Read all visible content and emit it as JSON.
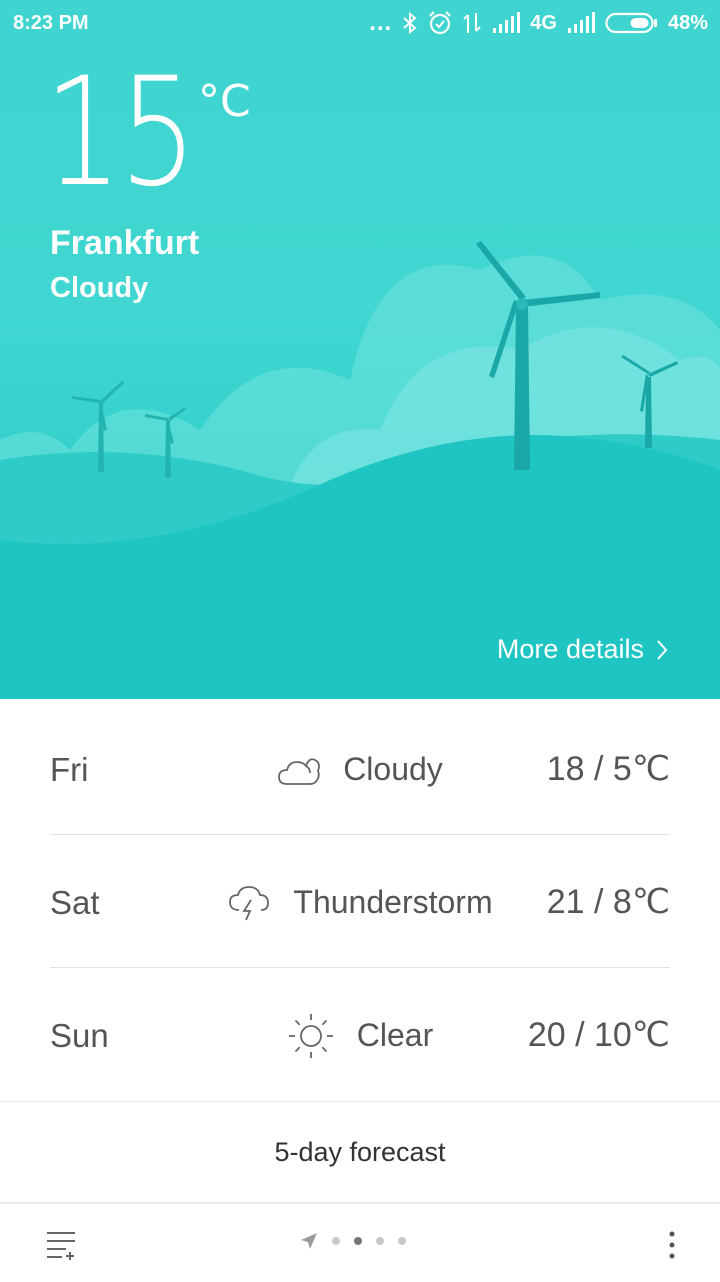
{
  "status_bar": {
    "time": "8:23 PM",
    "network": "4G",
    "battery": "48%",
    "battery_level": 0.48,
    "icons": [
      "more-dots-icon",
      "bluetooth-icon",
      "alarm-icon",
      "data-arrows-icon",
      "signal-icon",
      "signal-icon",
      "battery-icon"
    ]
  },
  "current": {
    "temperature": "15",
    "unit": "°C",
    "city": "Frankfurt",
    "condition": "Cloudy"
  },
  "more_details": "More details",
  "forecast": [
    {
      "day": "Fri",
      "condition": "Cloudy",
      "icon": "cloud-icon",
      "range": "18 / 5℃"
    },
    {
      "day": "Sat",
      "condition": "Thunderstorm",
      "icon": "thunderstorm-icon",
      "range": "21 / 8℃"
    },
    {
      "day": "Sun",
      "condition": "Clear",
      "icon": "sun-icon",
      "range": "20 / 10℃"
    }
  ],
  "five_day_label": "5-day forecast",
  "bottom_bar": {
    "menu_icon": "city-list-icon",
    "location_icon": "location-arrow-icon",
    "pages": 4,
    "active_page": 2,
    "overflow_icon": "overflow-menu-icon"
  },
  "colors": {
    "hero_top": "#3fd4cf",
    "hero_bottom": "#1cc4c2",
    "text": "#555555"
  }
}
